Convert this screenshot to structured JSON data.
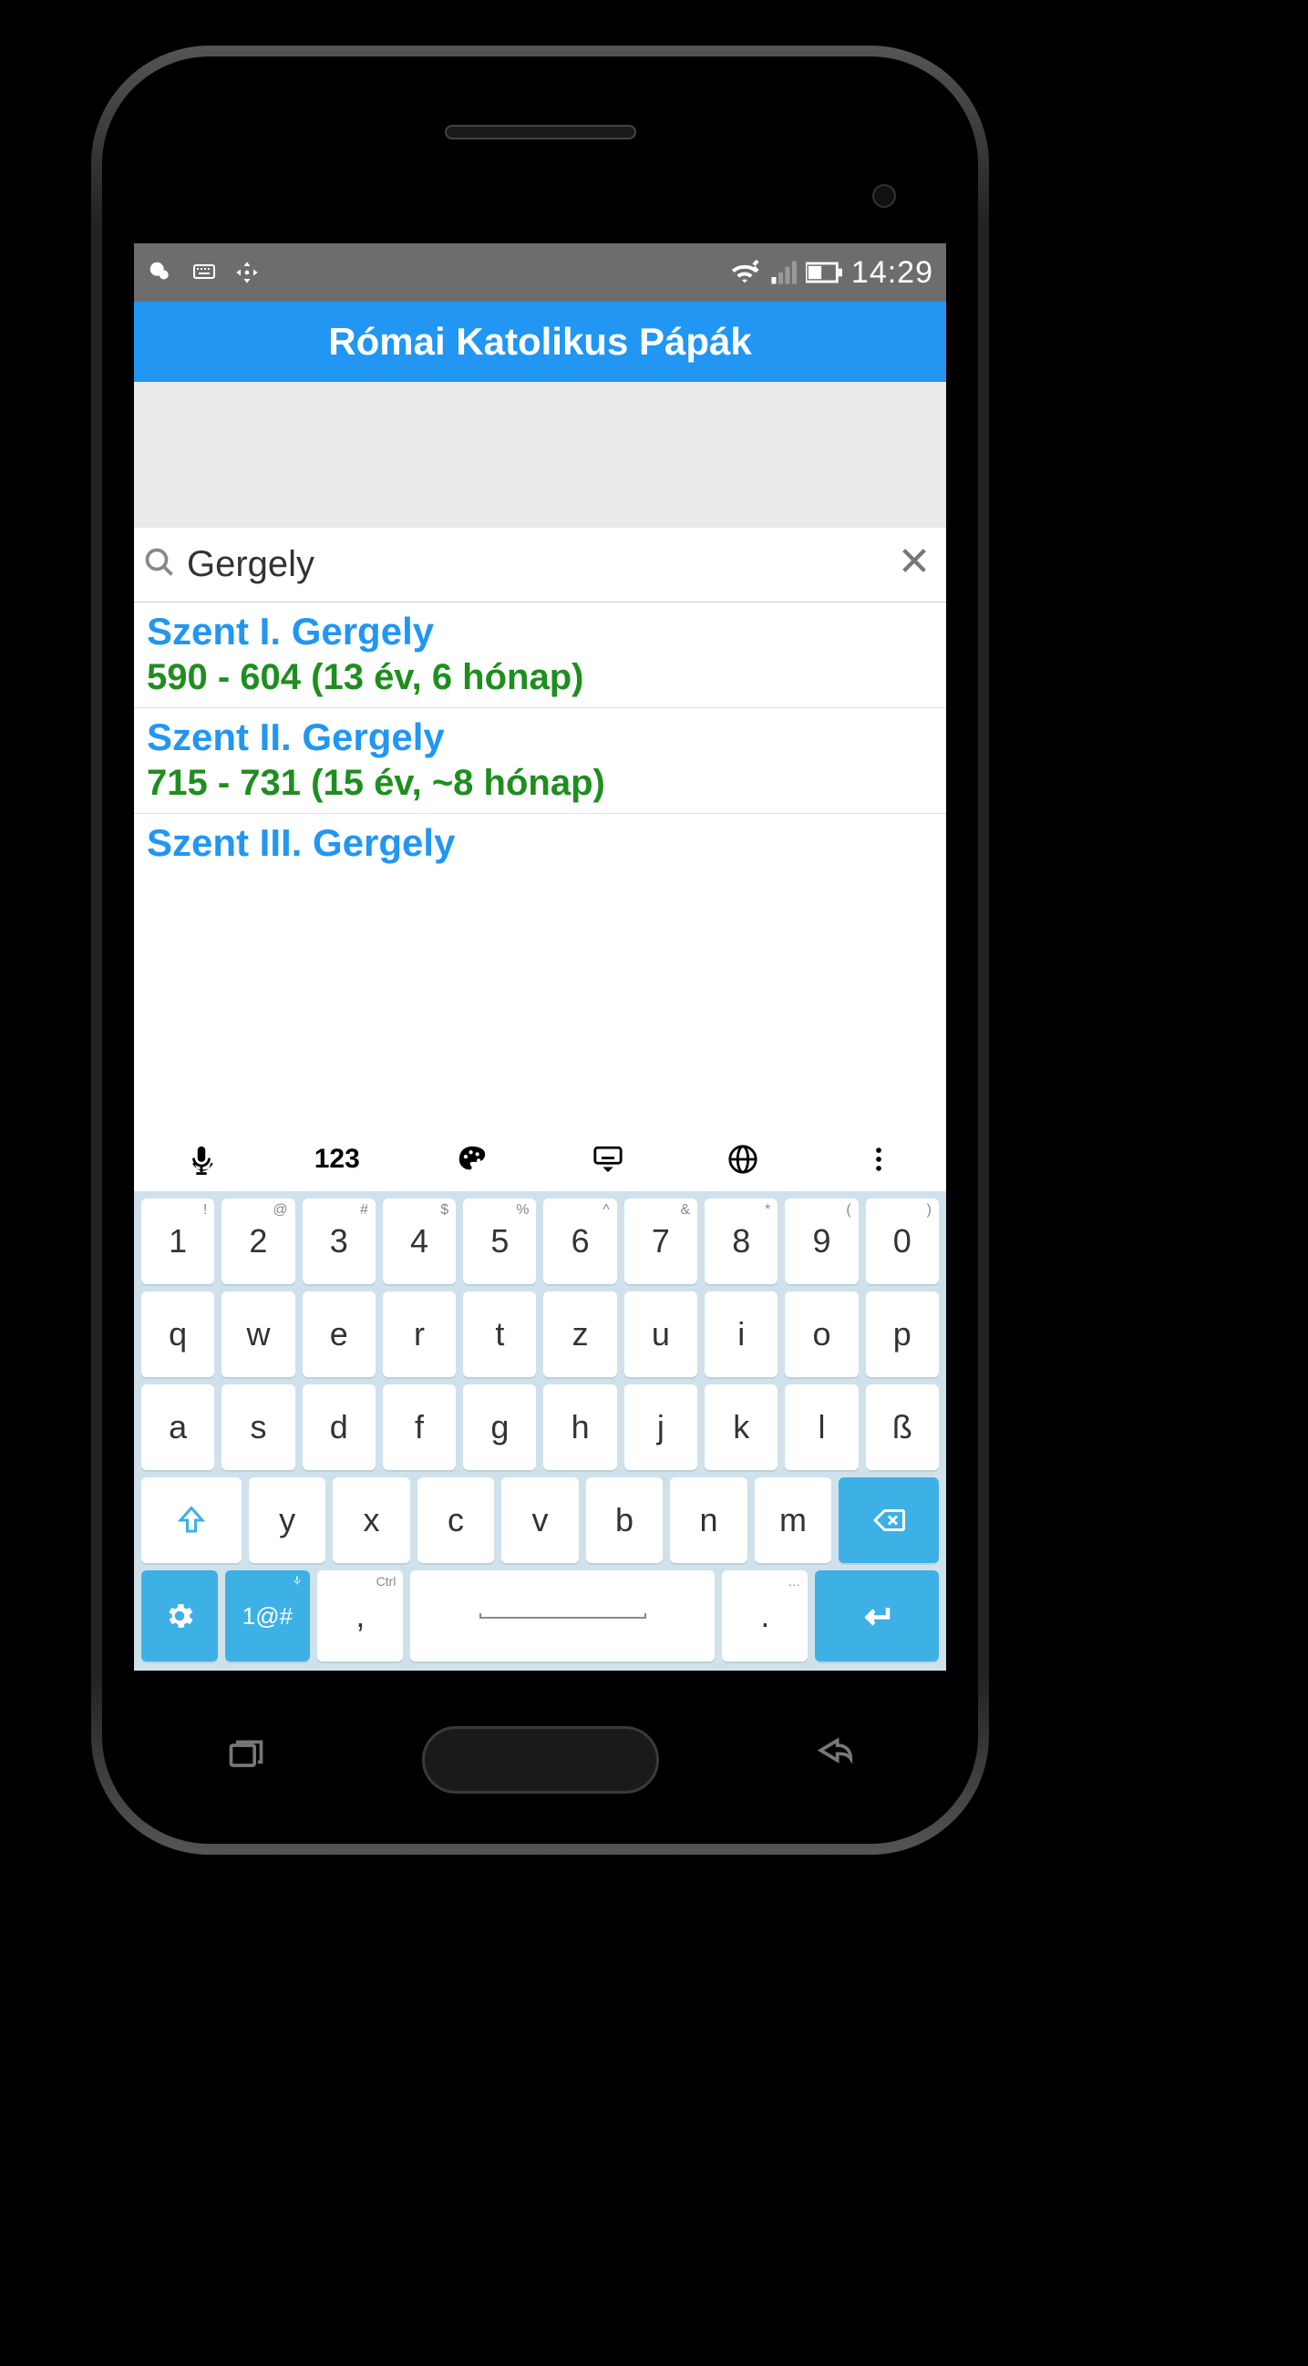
{
  "status": {
    "time": "14:29"
  },
  "app": {
    "title": "Római Katolikus Pápák"
  },
  "search": {
    "value": "Gergely",
    "placeholder": ""
  },
  "results": [
    {
      "name": "Szent I. Gergely",
      "reign": "590 - 604 (13 év, 6 hónap)"
    },
    {
      "name": "Szent II. Gergely",
      "reign": "715 - 731 (15 év, ~8 hónap)"
    },
    {
      "name": "Szent III. Gergely",
      "reign": ""
    }
  ],
  "keyboard": {
    "toolbar": {
      "numbers_label": "123"
    },
    "row1": [
      {
        "main": "1",
        "sec": "!"
      },
      {
        "main": "2",
        "sec": "@"
      },
      {
        "main": "3",
        "sec": "#"
      },
      {
        "main": "4",
        "sec": "$"
      },
      {
        "main": "5",
        "sec": "%"
      },
      {
        "main": "6",
        "sec": "^"
      },
      {
        "main": "7",
        "sec": "&"
      },
      {
        "main": "8",
        "sec": "*"
      },
      {
        "main": "9",
        "sec": "("
      },
      {
        "main": "0",
        "sec": ")"
      }
    ],
    "row2": [
      {
        "main": "q"
      },
      {
        "main": "w"
      },
      {
        "main": "e"
      },
      {
        "main": "r"
      },
      {
        "main": "t"
      },
      {
        "main": "z"
      },
      {
        "main": "u"
      },
      {
        "main": "i"
      },
      {
        "main": "o"
      },
      {
        "main": "p"
      }
    ],
    "row3": [
      {
        "main": "a"
      },
      {
        "main": "s"
      },
      {
        "main": "d"
      },
      {
        "main": "f"
      },
      {
        "main": "g"
      },
      {
        "main": "h"
      },
      {
        "main": "j"
      },
      {
        "main": "k"
      },
      {
        "main": "l"
      },
      {
        "main": "ß"
      }
    ],
    "row4": [
      {
        "main": "y"
      },
      {
        "main": "x"
      },
      {
        "main": "c"
      },
      {
        "main": "v"
      },
      {
        "main": "b"
      },
      {
        "main": "n"
      },
      {
        "main": "m"
      }
    ],
    "bottom": {
      "symbols_label": "1@#",
      "comma": ",",
      "period": ".",
      "comma_sec": "Ctrl",
      "period_sec": "…",
      "symbols_sec_icon": "mic"
    }
  }
}
